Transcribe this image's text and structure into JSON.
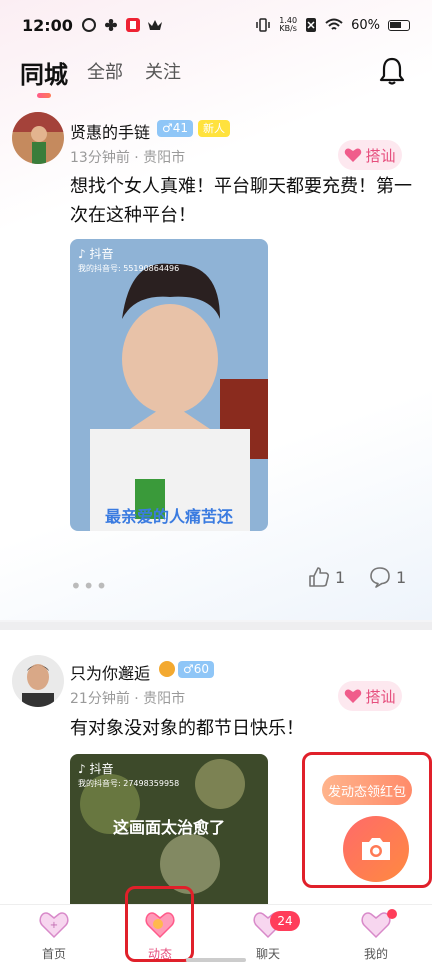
{
  "status_bar": {
    "time": "12:00",
    "speed_value": "1.40",
    "speed_unit": "KB/s",
    "battery": "60%",
    "icons": [
      "ring-icon",
      "fan-icon",
      "app-icon",
      "crown-icon",
      "vibrate-icon",
      "sim-off-icon",
      "wifi-icon",
      "battery-icon"
    ]
  },
  "tabs": [
    {
      "label": "同城",
      "active": true
    },
    {
      "label": "全部",
      "active": false
    },
    {
      "label": "关注",
      "active": false
    }
  ],
  "posts": [
    {
      "username": "贤惠的手链",
      "gender_badge": "♂41",
      "new_badge": "新人",
      "time": "13分钟前",
      "location": "· 贵阳市",
      "flirt_label": "搭讪",
      "text": "想找个女人真难！平台聊天都要充费！第一次在这种平台！",
      "video": {
        "brand": "抖音",
        "douyin_id": "我的抖音号: 55190864496",
        "caption": "最亲爱的人痛苦还"
      },
      "likes": "1",
      "comments": "1"
    },
    {
      "username": "只为你邂逅",
      "gender_badge": "♂60",
      "time": "21分钟前",
      "location": "· 贵阳市",
      "flirt_label": "搭讪",
      "text": "有对象没对象的都节日快乐！",
      "video": {
        "brand": "抖音",
        "douyin_id": "我的抖音号: 27498359958",
        "caption": "这画面太治愈了"
      }
    }
  ],
  "promo": {
    "label": "发动态领红包"
  },
  "bottom_nav": [
    {
      "label": "首页",
      "icon": "home-heart-icon"
    },
    {
      "label": "动态",
      "icon": "moments-heart-icon",
      "active": true
    },
    {
      "label": "聊天",
      "icon": "chat-heart-icon",
      "badge": "24"
    },
    {
      "label": "我的",
      "icon": "me-heart-icon"
    }
  ],
  "colors": {
    "accent": "#e64e7d",
    "highlight": "#e0202a",
    "gender_badge": "#8fc6f7",
    "new_badge": "#ffe23d"
  }
}
